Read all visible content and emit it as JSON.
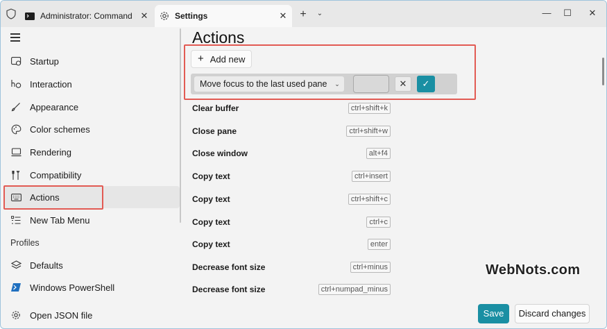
{
  "tabs": [
    {
      "title": "Administrator: Command Pr",
      "icon": "terminal-icon"
    },
    {
      "title": "Settings",
      "icon": "gear-icon"
    }
  ],
  "sidebar": {
    "items": [
      {
        "label": "Startup",
        "icon": "startup-icon"
      },
      {
        "label": "Interaction",
        "icon": "interaction-icon"
      },
      {
        "label": "Appearance",
        "icon": "brush-icon"
      },
      {
        "label": "Color schemes",
        "icon": "palette-icon"
      },
      {
        "label": "Rendering",
        "icon": "monitor-icon"
      },
      {
        "label": "Compatibility",
        "icon": "compatibility-icon"
      },
      {
        "label": "Actions",
        "icon": "keyboard-icon",
        "selected": true
      },
      {
        "label": "New Tab Menu",
        "icon": "list-icon"
      }
    ],
    "profiles_header": "Profiles",
    "profiles": [
      {
        "label": "Defaults",
        "icon": "layers-icon"
      },
      {
        "label": "Windows PowerShell",
        "icon": "powershell-icon"
      }
    ],
    "open_json": {
      "label": "Open JSON file",
      "icon": "gear-icon"
    }
  },
  "main": {
    "title": "Actions",
    "add_new_label": "Add new",
    "edit_row": {
      "selected_action": "Move focus to the last used pane"
    },
    "actions": [
      {
        "name": "Clear buffer",
        "key": "ctrl+shift+k"
      },
      {
        "name": "Close pane",
        "key": "ctrl+shift+w"
      },
      {
        "name": "Close window",
        "key": "alt+f4"
      },
      {
        "name": "Copy text",
        "key": "ctrl+insert"
      },
      {
        "name": "Copy text",
        "key": "ctrl+shift+c"
      },
      {
        "name": "Copy text",
        "key": "ctrl+c"
      },
      {
        "name": "Copy text",
        "key": "enter"
      },
      {
        "name": "Decrease font size",
        "key": "ctrl+minus"
      },
      {
        "name": "Decrease font size",
        "key": "ctrl+numpad_minus"
      }
    ]
  },
  "footer": {
    "save_label": "Save",
    "discard_label": "Discard changes"
  },
  "watermark": "WebNots.com",
  "colors": {
    "accent": "#1a8fa3",
    "highlight": "#e25a53"
  }
}
